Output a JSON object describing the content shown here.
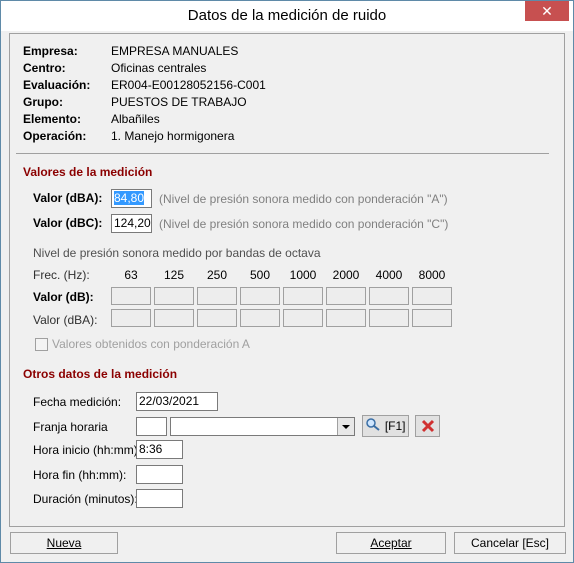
{
  "window": {
    "title": "Datos de la medición de ruido",
    "close_glyph": "✕"
  },
  "info": [
    {
      "label": "Empresa:",
      "value": "EMPRESA MANUALES"
    },
    {
      "label": "Centro:",
      "value": "Oficinas centrales"
    },
    {
      "label": "Evaluación:",
      "value": "ER004-E00128052156-C001"
    },
    {
      "label": "Grupo:",
      "value": "PUESTOS DE TRABAJO"
    },
    {
      "label": "Elemento:",
      "value": "Albañiles"
    },
    {
      "label": "Operación:",
      "value": "1. Manejo hormigonera"
    }
  ],
  "medicion": {
    "section_title": "Valores de la medición",
    "dba_label": "Valor (dBA):",
    "dba_value": "84,80",
    "dba_hint": "(Nivel de presión sonora medido con ponderación \"A\")",
    "dbc_label": "Valor (dBC):",
    "dbc_value": "124,20",
    "dbc_hint": "(Nivel de presión sonora medido con ponderación \"C\")",
    "octave_title": "Nivel de presión sonora medido por bandas de octava",
    "freq_label": "Frec. (Hz):",
    "freqs": [
      "63",
      "125",
      "250",
      "500",
      "1000",
      "2000",
      "4000",
      "8000"
    ],
    "row_db_label": "Valor (dB):",
    "row_dba_label": "Valor (dBA):",
    "checkbox_label": "Valores obtenidos con ponderación A"
  },
  "otros": {
    "section_title": "Otros datos de la medición",
    "fecha_label": "Fecha medición:",
    "fecha_value": "22/03/2021",
    "franja_label": "Franja horaria",
    "franja_code": "",
    "franja_value": "",
    "f1_label": "[F1]",
    "hora_inicio_label": "Hora inicio (hh:mm):",
    "hora_inicio_value": "8:36",
    "hora_fin_label": "Hora fin (hh:mm):",
    "hora_fin_value": "",
    "duracion_label": "Duración (minutos):",
    "duracion_value": ""
  },
  "footer": {
    "nueva": "Nueva",
    "aceptar": "Aceptar",
    "cancelar": "Cancelar  [Esc]"
  },
  "colors": {
    "section": "#8b0000",
    "selection": "#3399ff",
    "delete": "#d03030"
  }
}
